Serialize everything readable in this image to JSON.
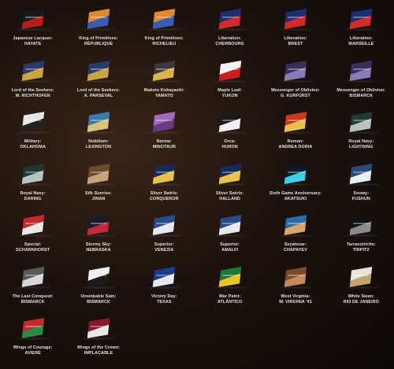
{
  "items": [
    {
      "line1": "Japanese Lacquer:",
      "line2": "HAYATE",
      "colors": [
        "#1a1a1a",
        "#b21d1d"
      ]
    },
    {
      "line1": "King of Primitives:",
      "line2": "RÉPUBLIQUE",
      "colors": [
        "#e08a2a",
        "#3b5bb5"
      ]
    },
    {
      "line1": "King of Primitives:",
      "line2": "RICHELIEU",
      "colors": [
        "#e08a2a",
        "#3b5bb5"
      ]
    },
    {
      "line1": "Liberation:",
      "line2": "CHERBOURG",
      "colors": [
        "#1d2f6e",
        "#d42a2a"
      ]
    },
    {
      "line1": "Liberation:",
      "line2": "BREST",
      "colors": [
        "#1d2f6e",
        "#d42a2a"
      ]
    },
    {
      "line1": "Liberation:",
      "line2": "MARSEILLE",
      "colors": [
        "#1d2f6e",
        "#d42a2a"
      ]
    },
    {
      "line1": "Lord of the Seekers:",
      "line2": "M. RICHTHOFEN",
      "colors": [
        "#2a3a6a",
        "#c9a440"
      ]
    },
    {
      "line1": "Lord of the Seekers:",
      "line2": "A. PARSEVAL",
      "colors": [
        "#2a3a6a",
        "#c9a440"
      ]
    },
    {
      "line1": "Makoto Kobayashi:",
      "line2": "YAMATO",
      "colors": [
        "#3a3a3a",
        "#d8b44a"
      ]
    },
    {
      "line1": "Maple Leaf:",
      "line2": "YUKON",
      "colors": [
        "#f2f2f2",
        "#c81e1e"
      ]
    },
    {
      "line1": "Messenger of Oblivion:",
      "line2": "G. KURFÜRST",
      "colors": [
        "#3b2e5a",
        "#8a7ab8"
      ]
    },
    {
      "line1": "Messenger of Oblivion:",
      "line2": "BISMARCK",
      "colors": [
        "#3b2e5a",
        "#8a7ab8"
      ]
    },
    {
      "line1": "Military:",
      "line2": "OKLAHOMA",
      "colors": [
        "#e6e6e6",
        "#222222"
      ]
    },
    {
      "line1": "Nobilium:",
      "line2": "LEXINGTON",
      "colors": [
        "#3a7aa8",
        "#d8c27a"
      ]
    },
    {
      "line1": "Norma:",
      "line2": "MINOTAUR",
      "colors": [
        "#a06ab8",
        "#6a3a80"
      ]
    },
    {
      "line1": "Orca:",
      "line2": "HURON",
      "colors": [
        "#1a1a1a",
        "#f0f0f0"
      ]
    },
    {
      "line1": "Roman:",
      "line2": "ANDREA DORIA",
      "colors": [
        "#c43a1a",
        "#e8c04a"
      ]
    },
    {
      "line1": "Royal Navy:",
      "line2": "LIGHTNING",
      "colors": [
        "#1f3a33",
        "#b8c2bf"
      ]
    },
    {
      "line1": "Royal Navy:",
      "line2": "DARING",
      "colors": [
        "#1f3a33",
        "#b8c2bf"
      ]
    },
    {
      "line1": "Silk Sunrise:",
      "line2": "JINAN",
      "colors": [
        "#6a4a2a",
        "#c4a478"
      ]
    },
    {
      "line1": "Silver Swirls:",
      "line2": "CONQUEROR",
      "colors": [
        "#1a2a5a",
        "#e8c24a"
      ]
    },
    {
      "line1": "Silver Swirls:",
      "line2": "HALLAND",
      "colors": [
        "#1a2a5a",
        "#e8c24a"
      ]
    },
    {
      "line1": "Sixth Game Anniversary:",
      "line2": "AKATSUKI",
      "colors": [
        "#0c1c24",
        "#3ad0e8"
      ]
    },
    {
      "line1": "Snowy:",
      "line2": "FUSHUN",
      "colors": [
        "#2a4a7a",
        "#e8f0f8"
      ]
    },
    {
      "line1": "Special:",
      "line2": "SCHARNHORST",
      "colors": [
        "#c42a2a",
        "#e8e8e8"
      ]
    },
    {
      "line1": "Stormy Sky:",
      "line2": "NEBRASKA",
      "colors": [
        "#1a1a2a",
        "#c42a3a"
      ]
    },
    {
      "line1": "Superior:",
      "line2": "VENEZIA",
      "colors": [
        "#2a4a8a",
        "#e8e8f0"
      ]
    },
    {
      "line1": "Superior:",
      "line2": "AMALFI",
      "colors": [
        "#2a4a8a",
        "#e8e8f0"
      ]
    },
    {
      "line1": "Svyatozar:",
      "line2": "CHAPAYEV",
      "colors": [
        "#2a6aa8",
        "#d8a86a"
      ]
    },
    {
      "line1": "Tarrasotriche:",
      "line2": "TIRPITZ",
      "colors": [
        "#121212",
        "#8a8a8a"
      ]
    },
    {
      "line1": "The Last Conquest:",
      "line2": "BISMARCK",
      "colors": [
        "#5a5a5a",
        "#d8d8d8"
      ]
    },
    {
      "line1": "Unsinkable Sam:",
      "line2": "BISMARCK",
      "colors": [
        "#f0f0f0",
        "#1a1a1a"
      ]
    },
    {
      "line1": "Victory Day:",
      "line2": "TEXAS",
      "colors": [
        "#1a3a8a",
        "#e8e8f0"
      ]
    },
    {
      "line1": "War Paint:",
      "line2": "ATLÁNTICO",
      "colors": [
        "#1a7a3a",
        "#e8c42a"
      ]
    },
    {
      "line1": "West Virginia:",
      "line2": "W. VIRGINIA '41",
      "colors": [
        "#7a4a2a",
        "#c48a5a"
      ]
    },
    {
      "line1": "White Swan:",
      "line2": "RIO DE JANEIRO",
      "colors": [
        "#e8e4d8",
        "#c4a46a"
      ]
    },
    {
      "line1": "Wings of Courage:",
      "line2": "AVIERE",
      "colors": [
        "#c42a2a",
        "#2a8a4a"
      ]
    },
    {
      "line1": "Wings of the Crown:",
      "line2": "IMPLACABLE",
      "colors": [
        "#8a1a2a",
        "#e8e8e8"
      ]
    }
  ]
}
